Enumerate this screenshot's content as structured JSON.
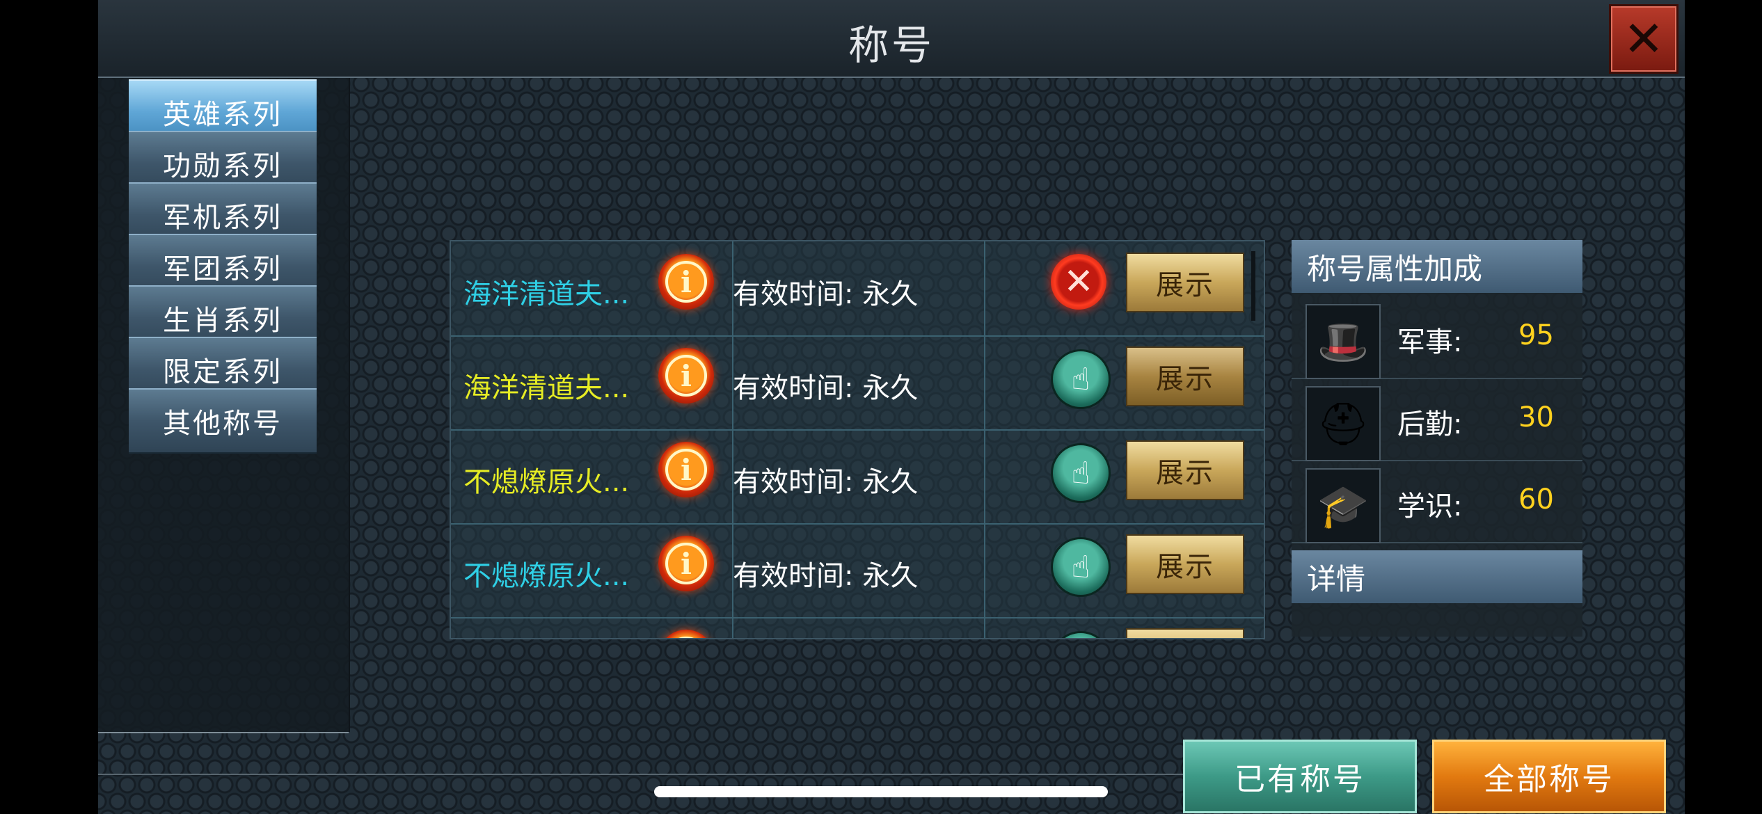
{
  "header": {
    "title": "称号",
    "close_icon": "close-x-icon"
  },
  "sidebar": {
    "items": [
      {
        "label": "英雄系列",
        "active": true
      },
      {
        "label": "功勋系列",
        "active": false
      },
      {
        "label": "军机系列",
        "active": false
      },
      {
        "label": "军团系列",
        "active": false
      },
      {
        "label": "生肖系列",
        "active": false
      },
      {
        "label": "限定系列",
        "active": false
      },
      {
        "label": "其他称号",
        "active": false
      }
    ]
  },
  "titles": {
    "rows": [
      {
        "name": "海洋清道夫...",
        "name_color": "#2fd0e6",
        "time": "有效时间: 永久",
        "state": "cancel-icon",
        "button": "展示"
      },
      {
        "name": "海洋清道夫...",
        "name_color": "#e6ec24",
        "time": "有效时间: 永久",
        "state": "hand-pointer-icon",
        "button": "展示"
      },
      {
        "name": "不熄燎原火...",
        "name_color": "#e6ec24",
        "time": "有效时间: 永久",
        "state": "hand-pointer-icon",
        "button": "展示"
      },
      {
        "name": "不熄燎原火...",
        "name_color": "#2fd0e6",
        "time": "有效时间: 永久",
        "state": "hand-pointer-icon",
        "button": "展示"
      }
    ]
  },
  "attributes": {
    "header": "称号属性加成",
    "items": [
      {
        "label": "军事:",
        "value": "95",
        "icon": "officer-cap-pistol-icon"
      },
      {
        "label": "后勤:",
        "value": "30",
        "icon": "helmet-pickaxe-icon"
      },
      {
        "label": "学识:",
        "value": "60",
        "icon": "graduation-cap-icon"
      }
    ],
    "details_header": "详情"
  },
  "tabs": {
    "owned": "已有称号",
    "all": "全部称号"
  },
  "colors": {
    "value_yellow": "#ffd21e",
    "active_tab": "#e27a10",
    "teal_tab": "#3d9a87"
  }
}
